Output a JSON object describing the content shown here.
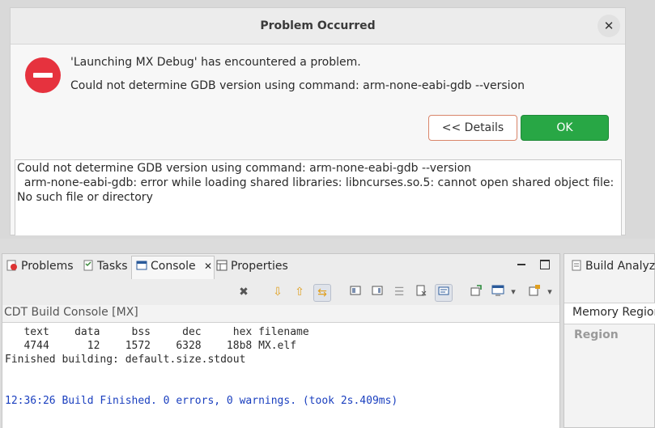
{
  "dialog": {
    "title": "Problem Occurred",
    "close_glyph": "✕",
    "message_primary": "'Launching MX Debug' has encountered a problem.",
    "message_secondary": "Could not determine GDB version using command: arm-none-eabi-gdb --version",
    "details_button": "<< Details",
    "ok_button": "OK",
    "details_text": "Could not determine GDB version using command: arm-none-eabi-gdb --version\n  arm-none-eabi-gdb: error while loading shared libraries: libncurses.so.5: cannot open shared object file: No such file or directory"
  },
  "views": {
    "tabs": [
      {
        "label": "Problems",
        "icon": "problems-icon"
      },
      {
        "label": "Tasks",
        "icon": "tasks-icon"
      },
      {
        "label": "Console",
        "icon": "console-icon",
        "active": true
      },
      {
        "label": "Properties",
        "icon": "properties-icon"
      }
    ],
    "close_glyph": "✕",
    "console_name": "CDT Build Console [MX]",
    "console_lines": [
      "   text    data     bss     dec     hex filename",
      "   4744      12    1572    6328    18b8 MX.elf",
      "Finished building: default.size.stdout"
    ],
    "console_finish_line": "12:36:26 Build Finished. 0 errors, 0 warnings. (took 2s.409ms)"
  },
  "right_view": {
    "tab_label": "Build Analyzer",
    "sub_tab": "Memory Regions",
    "column_header": "Region"
  },
  "colors": {
    "error": "#e6323e",
    "ok_button": "#28a745",
    "console_blue": "#1a3fbf"
  }
}
